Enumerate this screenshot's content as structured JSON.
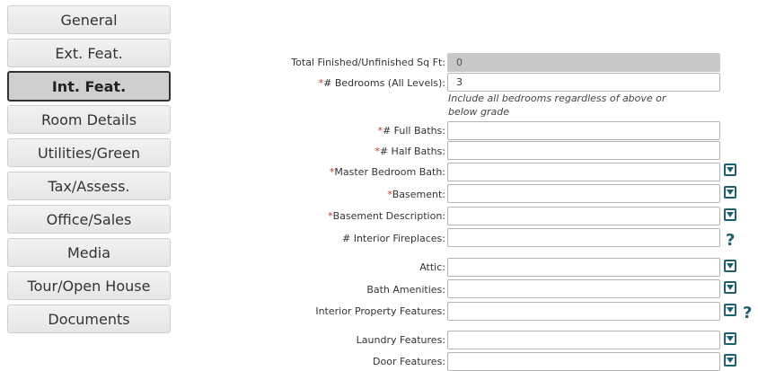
{
  "tabs": [
    {
      "label": "General"
    },
    {
      "label": "Ext. Feat."
    },
    {
      "label": "Int. Feat."
    },
    {
      "label": "Room Details"
    },
    {
      "label": "Utilities/Green"
    },
    {
      "label": "Tax/Assess."
    },
    {
      "label": "Office/Sales"
    },
    {
      "label": "Media"
    },
    {
      "label": "Tour/Open House"
    },
    {
      "label": "Documents"
    }
  ],
  "active_tab": "Int. Feat.",
  "form": {
    "total_sqft": {
      "label": "Total Finished/Unfinished Sq Ft:",
      "value": "0"
    },
    "bedrooms": {
      "required": "*",
      "label": "# Bedrooms (All Levels):",
      "value": "3",
      "hint": "Include all bedrooms regardless of above or below grade"
    },
    "full_baths": {
      "required": "*",
      "label": "# Full Baths:",
      "value": ""
    },
    "half_baths": {
      "required": "*",
      "label": "# Half Baths:",
      "value": ""
    },
    "master_bath": {
      "required": "*",
      "label": "Master Bedroom Bath:",
      "value": ""
    },
    "basement": {
      "required": "*",
      "label": "Basement:",
      "value": ""
    },
    "basement_desc": {
      "required": "*",
      "label": "Basement Description:",
      "value": ""
    },
    "fireplaces": {
      "label": "# Interior Fireplaces:",
      "value": "",
      "help": "?"
    },
    "attic": {
      "label": "Attic:",
      "value": ""
    },
    "bath_amenities": {
      "label": "Bath Amenities:",
      "value": ""
    },
    "interior_features": {
      "label": "Interior Property Features:",
      "value": "",
      "help": "?"
    },
    "laundry": {
      "label": "Laundry Features:",
      "value": ""
    },
    "door": {
      "label": "Door Features:",
      "value": ""
    }
  },
  "icons": {
    "dropdown": "dropdown-arrow-icon",
    "help": "help-question-icon"
  },
  "colors": {
    "accent": "#1f5f6e",
    "required": "#c0392b",
    "disabled_field": "#c8c8c8"
  }
}
